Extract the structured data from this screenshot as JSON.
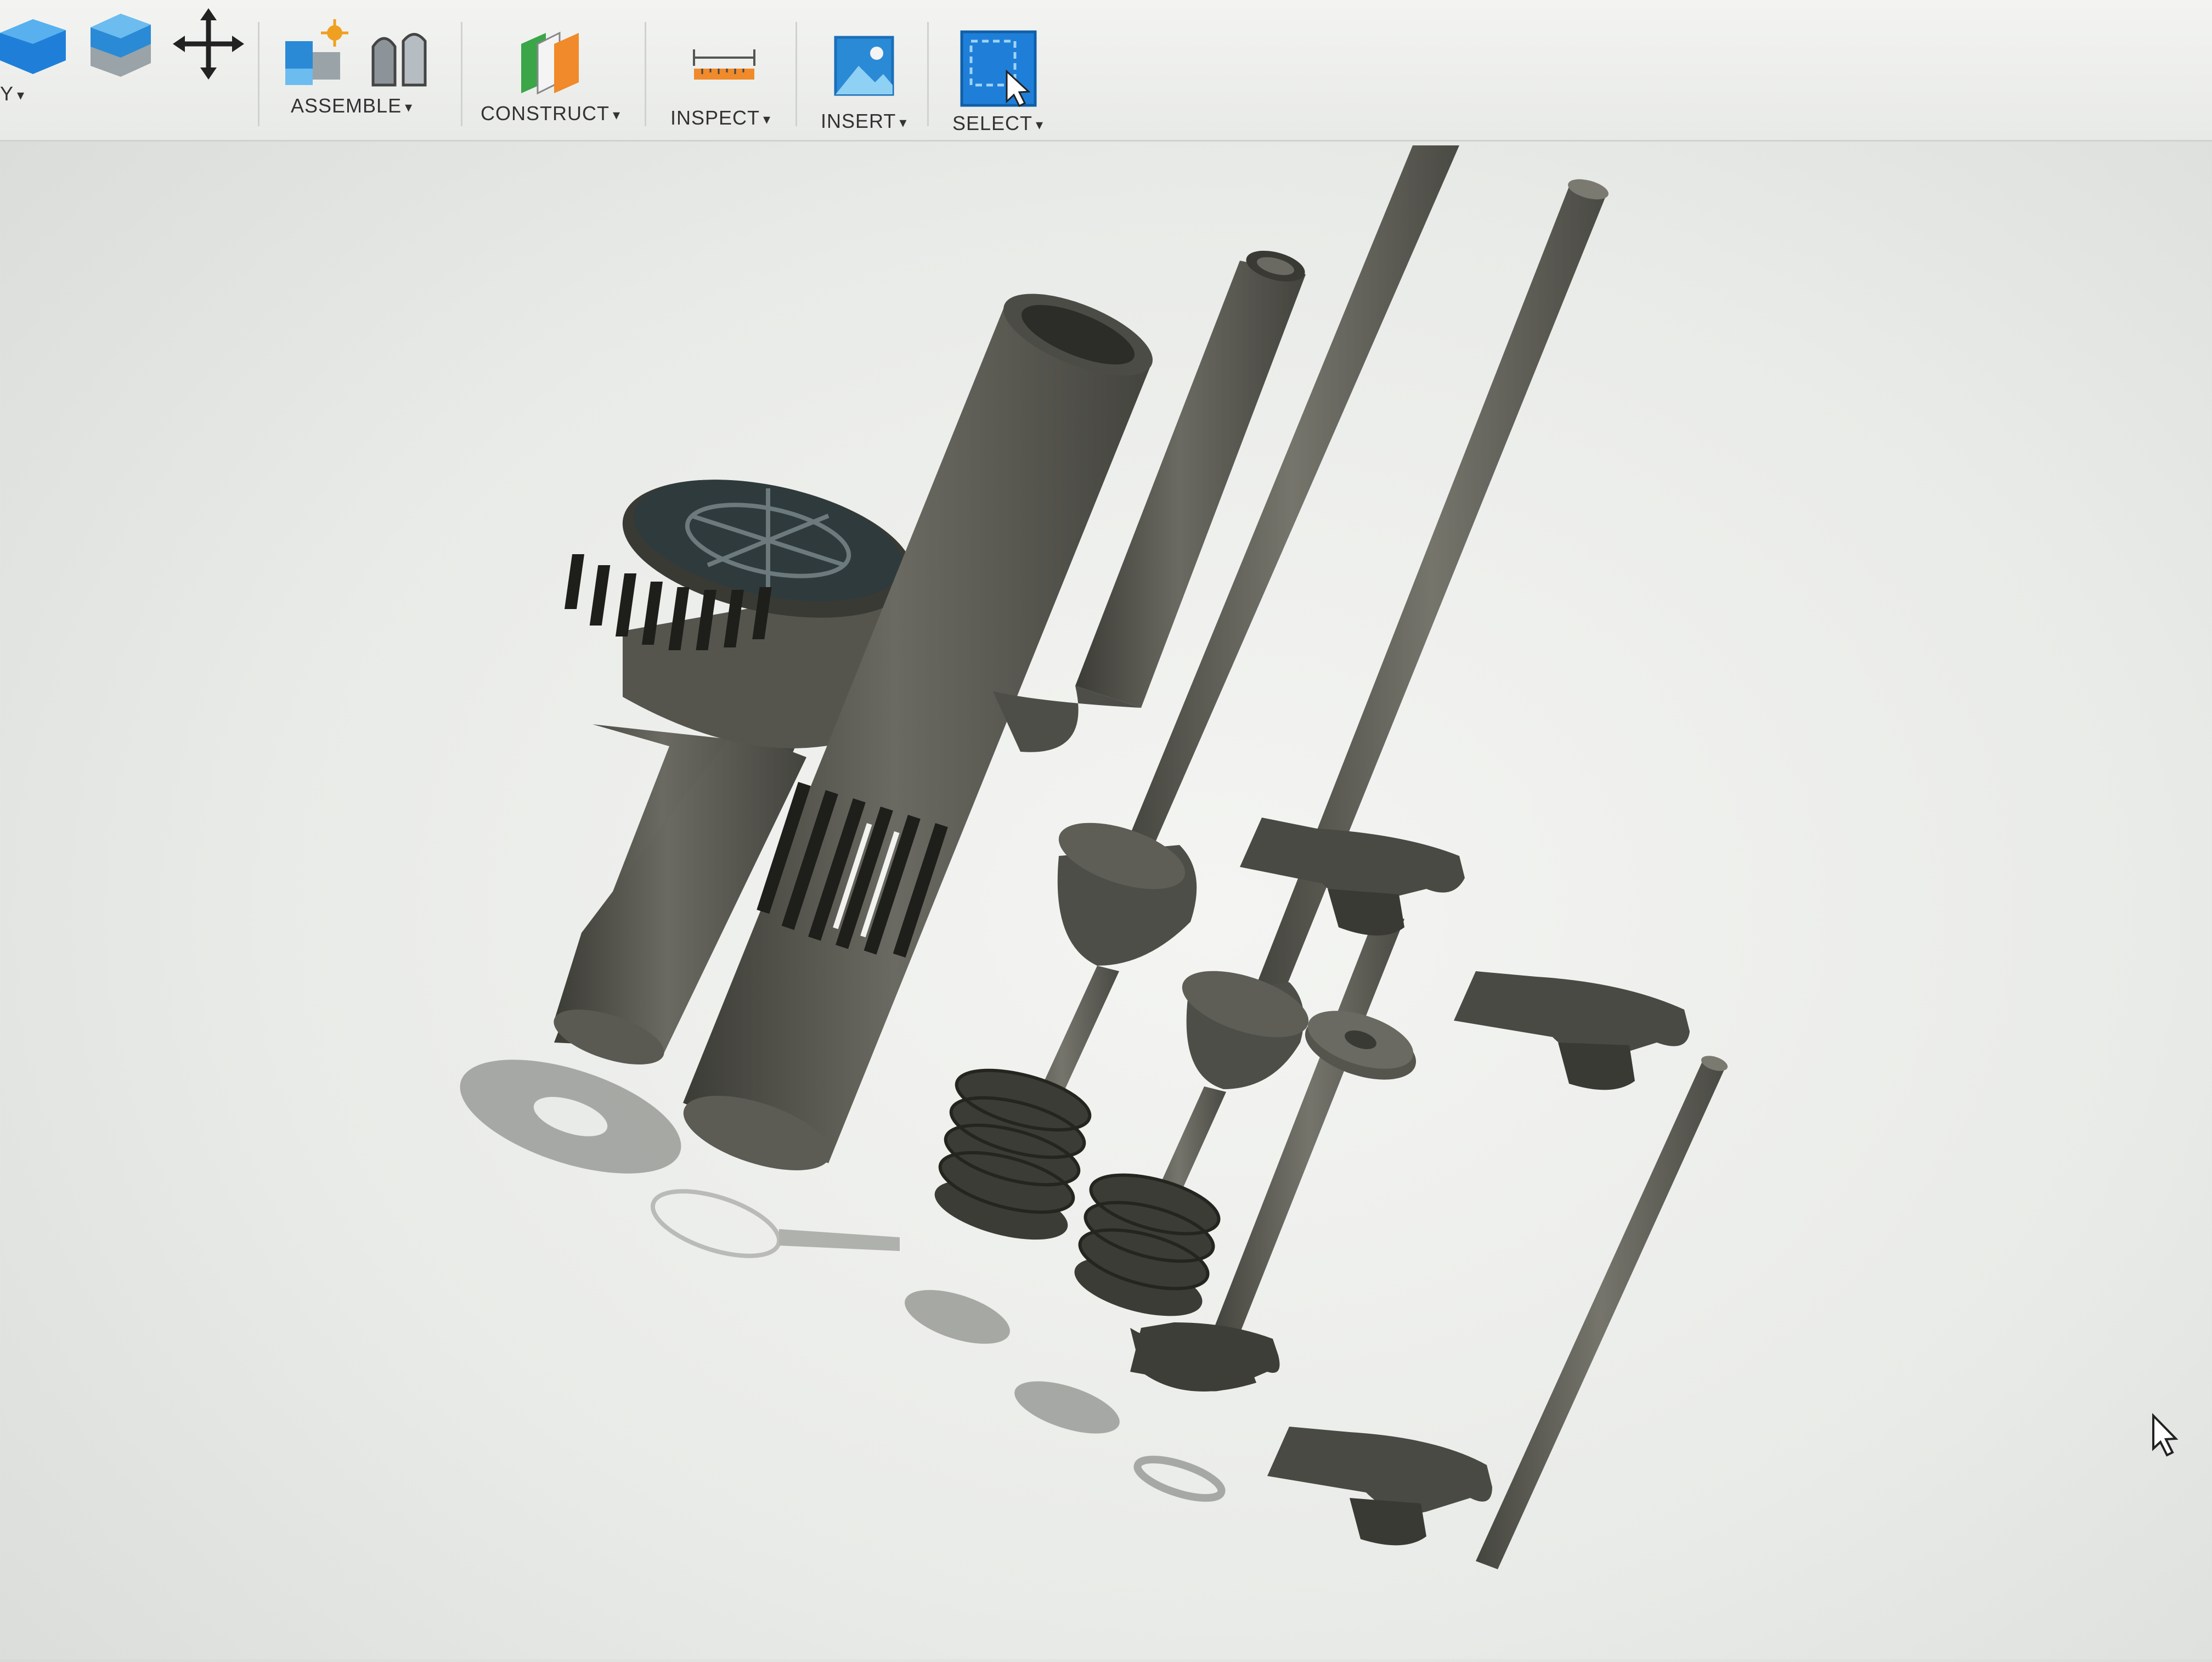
{
  "toolbar": {
    "partial_label": "Y",
    "tools": [
      {
        "id": "assemble",
        "label": "ASSEMBLE"
      },
      {
        "id": "construct",
        "label": "CONSTRUCT"
      },
      {
        "id": "inspect",
        "label": "INSPECT"
      },
      {
        "id": "insert",
        "label": "INSERT"
      },
      {
        "id": "select",
        "label": "SELECT"
      }
    ]
  },
  "colors": {
    "accent_blue": "#1f7fd8",
    "part_gray": "#5e5e57",
    "part_dark": "#3a3a35",
    "viewport_bg": "#eceeeb"
  },
  "icons": [
    "box-icon",
    "extrude-icon",
    "move-icon",
    "new-component-icon",
    "joint-icon",
    "offset-plane-icon",
    "measure-icon",
    "insert-image-icon",
    "select-icon",
    "mouse-cursor-icon"
  ]
}
